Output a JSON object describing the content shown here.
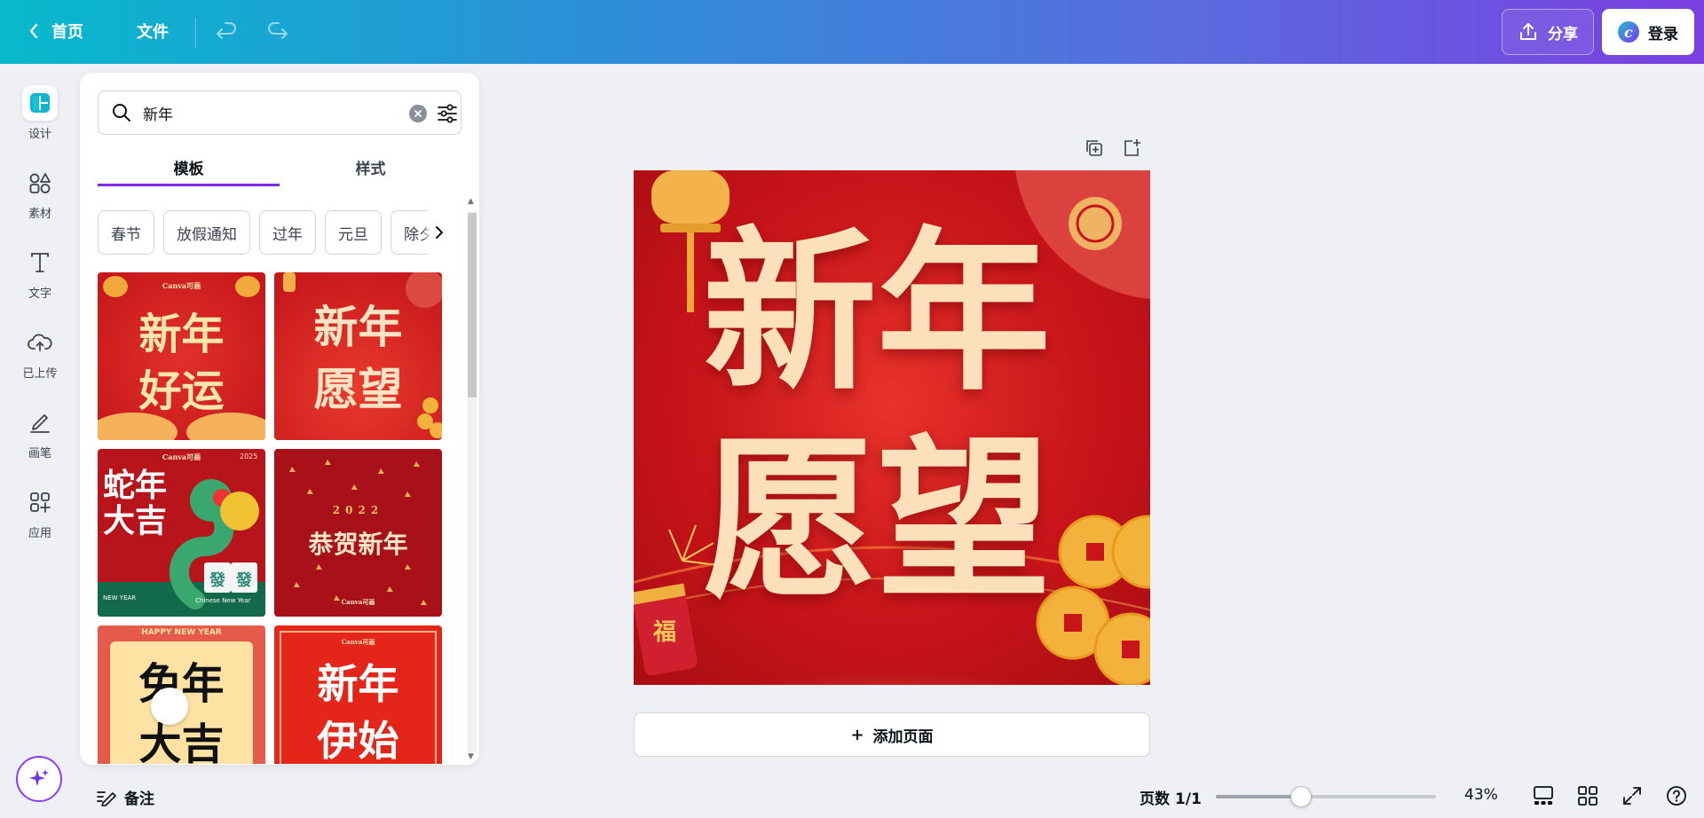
{
  "topbar": {
    "home_label": "首页",
    "file_label": "文件",
    "share_label": "分享",
    "login_label": "登录"
  },
  "rail": {
    "items": [
      {
        "label": "设计",
        "icon": "layout-icon"
      },
      {
        "label": "素材",
        "icon": "shapes-icon"
      },
      {
        "label": "文字",
        "icon": "text-icon"
      },
      {
        "label": "已上传",
        "icon": "cloud-upload-icon"
      },
      {
        "label": "画笔",
        "icon": "pen-icon"
      },
      {
        "label": "应用",
        "icon": "apps-icon"
      }
    ],
    "active": "设计"
  },
  "panel": {
    "search_value": "新年",
    "tabs": [
      {
        "label": "模板"
      },
      {
        "label": "样式"
      }
    ],
    "chips": [
      "春节",
      "放假通知",
      "过年",
      "元旦",
      "除夕"
    ],
    "thumbnails": [
      {
        "line1": "新年",
        "line2": "好运",
        "tag": "Canva可画"
      },
      {
        "line1": "新年",
        "line2": "愿望"
      },
      {
        "line1": "蛇年",
        "line2": "大吉",
        "tag": "Canva可画",
        "year": "2025",
        "footer_left": "NEW YEAR",
        "footer_right": "Chinese New Year",
        "badge": "發"
      },
      {
        "line1": "恭贺新年",
        "year": "2022",
        "tag": "Canva可画"
      },
      {
        "line1": "兔年",
        "line2": "大吉",
        "header": "HAPPY NEW YEAR",
        "side": "HAPPY NEW YEAR"
      },
      {
        "line1": "新年",
        "line2": "伊始",
        "tag": "Canva可画"
      }
    ]
  },
  "canvas": {
    "poster_line1": "新年",
    "poster_line2": "愿望",
    "fu_char": "福",
    "add_page_label": "添加页面"
  },
  "bottombar": {
    "notes_label": "备注",
    "page_count": "页数 1/1",
    "zoom_percent": "43%",
    "zoom_level": 0.43
  },
  "colors": {
    "accent": "#7d2ae8",
    "poster_red": "#c8141a",
    "poster_text": "#fbe0bb"
  }
}
